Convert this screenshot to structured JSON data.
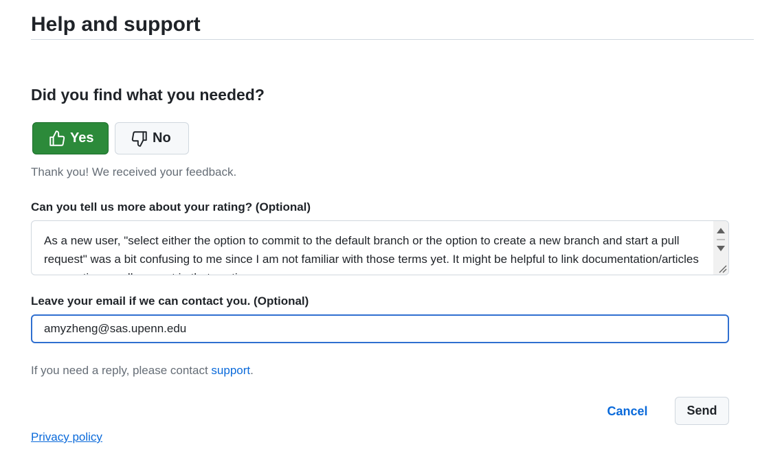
{
  "header": {
    "title": "Help and support"
  },
  "feedback": {
    "question": "Did you find what you needed?",
    "yes_label": "Yes",
    "no_label": "No",
    "thanks_text": "Thank you! We received your feedback."
  },
  "rating": {
    "label": "Can you tell us more about your rating? (Optional)",
    "value": "As a new user, \"select either the option to commit to the default branch or the option to create a new branch and start a pull request\" was a bit confusing to me since I am not familiar with those terms yet. It might be helpful to link documentation/articles on creating a pull request in that section."
  },
  "email": {
    "label": "Leave your email if we can contact you. (Optional)",
    "value": "amyzheng@sas.upenn.edu"
  },
  "reply": {
    "prefix": "If you need a reply, please contact ",
    "link_text": "support",
    "suffix": "."
  },
  "actions": {
    "cancel_label": "Cancel",
    "send_label": "Send"
  },
  "footer": {
    "privacy_label": "Privacy policy"
  },
  "colors": {
    "yes_button": "#2c8a3a",
    "link": "#0969da",
    "focus_border": "#2f6fd0"
  },
  "icons": {
    "yes": "thumbs-up-icon",
    "no": "thumbs-down-icon"
  }
}
